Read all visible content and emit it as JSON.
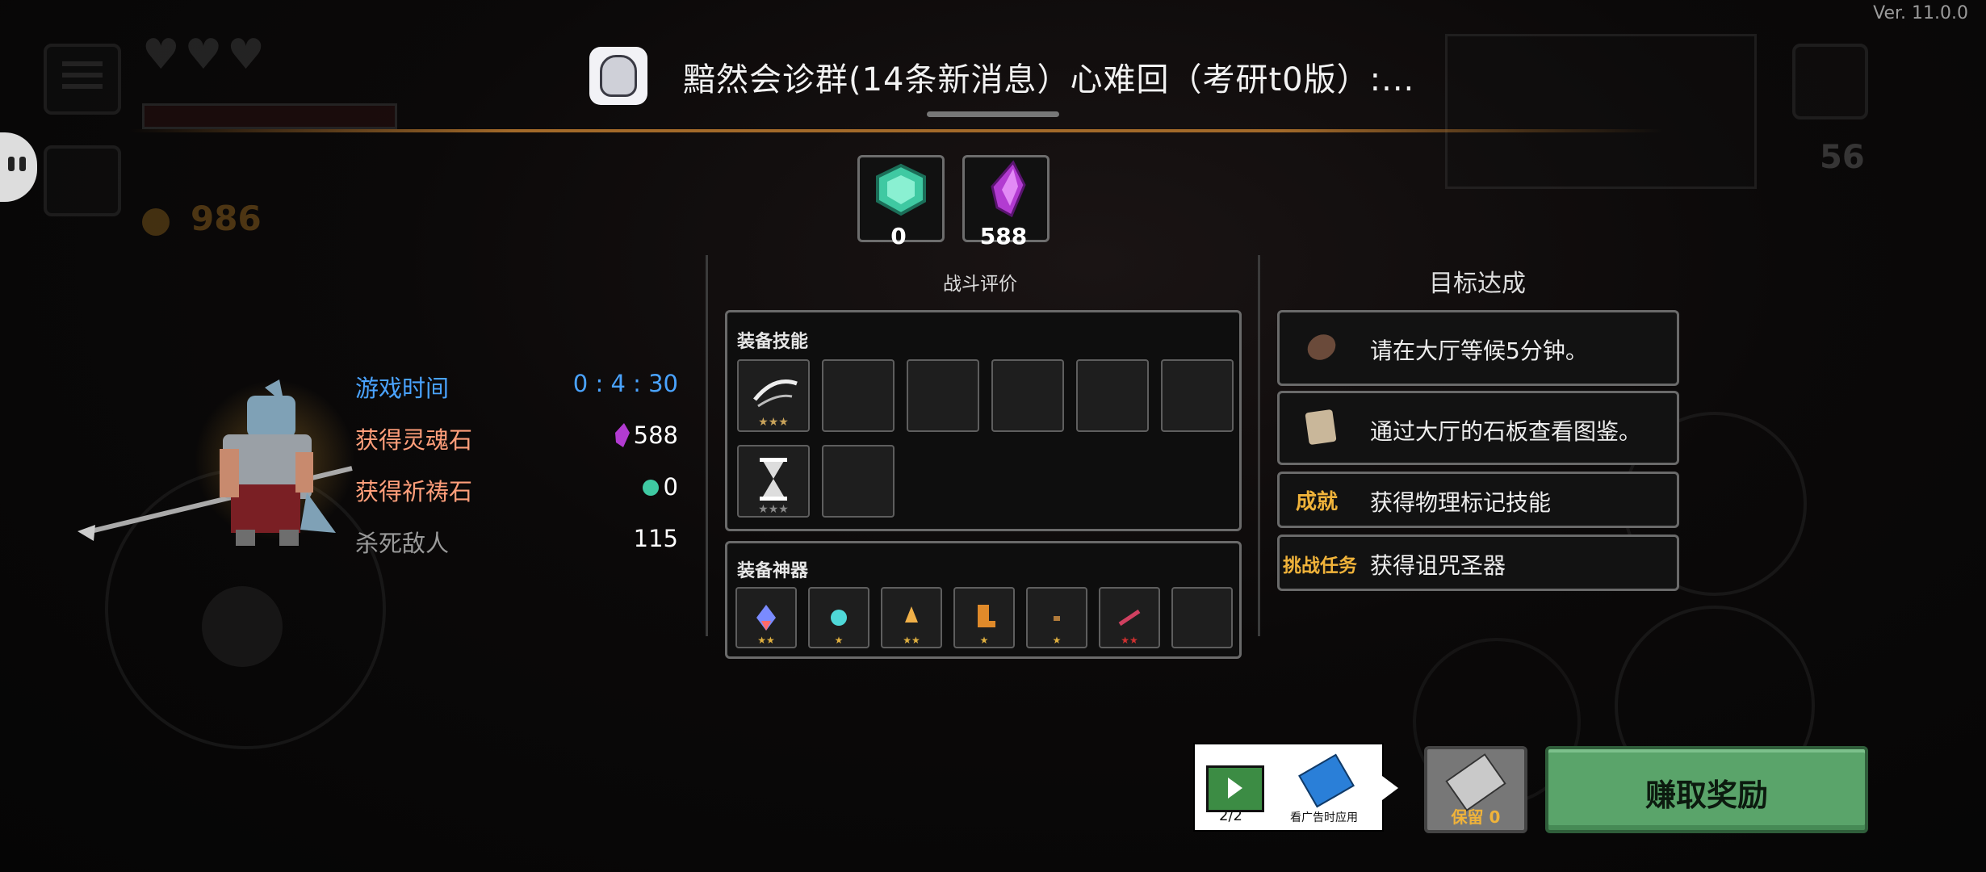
{
  "version": "Ver. 11.0.0",
  "notification": {
    "text": "黯然会诊群(14条新消息）心难回（考研t0版）:..."
  },
  "hud_background": {
    "gold_count": "986",
    "kill_count": "56"
  },
  "currencies": [
    {
      "name": "prayer-stone",
      "count": "0",
      "color": "#3fc9a2"
    },
    {
      "name": "soul-stone",
      "count": "588",
      "color": "#b23bd1"
    }
  ],
  "stats": {
    "play_time_label": "游戏时间",
    "play_time_value": "0 : 4 : 30",
    "soul_label": "获得灵魂石",
    "soul_value": "588",
    "prayer_label": "获得祈祷石",
    "prayer_value": "0",
    "kills_label": "杀死敌人",
    "kills_value": "115"
  },
  "battle": {
    "title": "战斗评价",
    "skills_title": "装备技能",
    "artifacts_title": "装备神器"
  },
  "goals": {
    "title": "目标达成",
    "items": [
      {
        "tag": "",
        "text": "请在大厅等候5分钟。"
      },
      {
        "tag": "",
        "text": "通过大厅的石板查看图鉴。"
      },
      {
        "tag": "成就",
        "text": "获得物理标记技能"
      },
      {
        "tag": "挑战任务",
        "text": "获得诅咒圣器"
      }
    ]
  },
  "buttons": {
    "ad_counter": "2/2",
    "ad_caption": "看广告时应用",
    "keep_label": "保留 0",
    "earn_label": "赚取奖励"
  },
  "colors": {
    "play_time_label": "#4aa3ff",
    "play_time_value": "#4aa3ff",
    "soul_label": "#ff9e7a",
    "prayer_label": "#ff9e7a",
    "kills_label": "#9a9a9a",
    "goal_tag": "#f0b33a",
    "earn_button": "#5aa46a"
  }
}
